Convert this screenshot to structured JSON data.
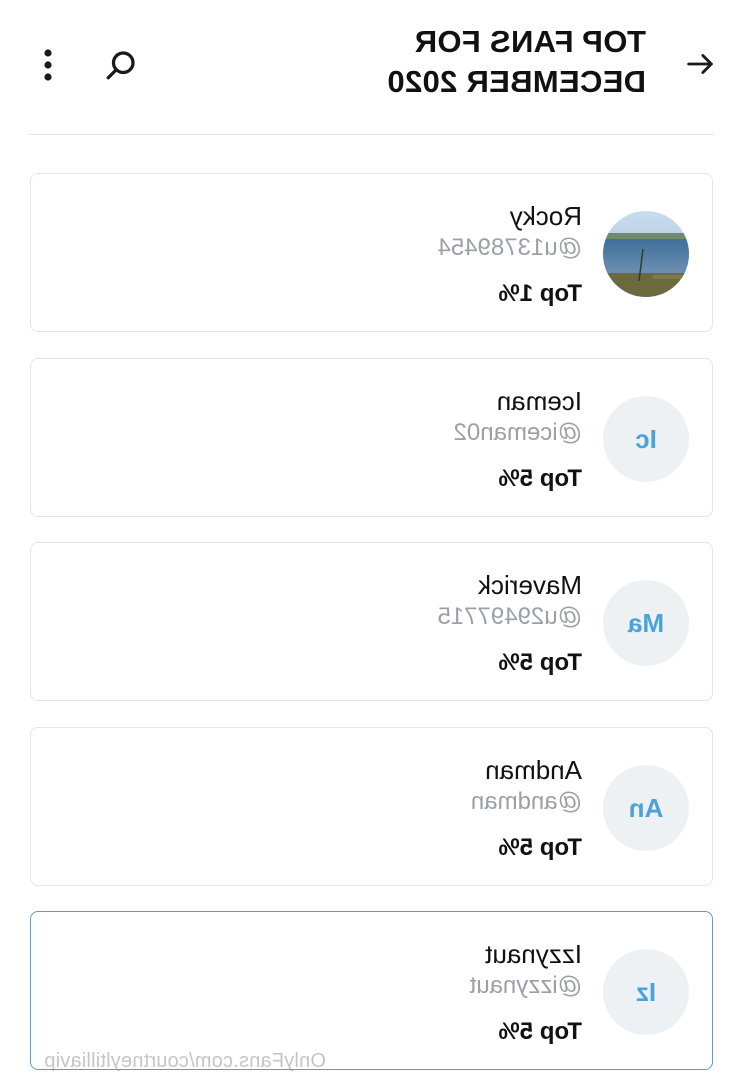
{
  "header": {
    "title": "TOP FANS FOR DECEMBER 2020",
    "back_icon": "arrow-left-icon",
    "search_icon": "search-icon",
    "more_icon": "more-vertical-icon"
  },
  "fans": [
    {
      "initials": "",
      "avatar": "photo",
      "name": "Rocky",
      "handle": "@u13789454",
      "rank": "Top 1%"
    },
    {
      "initials": "Ic",
      "avatar": "initials",
      "name": "Iceman",
      "handle": "@iceman02",
      "rank": "Top 5%"
    },
    {
      "initials": "Ma",
      "avatar": "initials",
      "name": "Maverick",
      "handle": "@u29497715",
      "rank": "Top 5%"
    },
    {
      "initials": "An",
      "avatar": "initials",
      "name": "Andman",
      "handle": "@andman",
      "rank": "Top 5%"
    },
    {
      "initials": "Iz",
      "avatar": "initials",
      "name": "Izzynaut",
      "handle": "@izzynaut",
      "rank": "Top 5%"
    }
  ],
  "watermark": "OnlyFans.com/courtneyltilliavip",
  "colors": {
    "accent": "#4ba3d7",
    "active_border": "#5d9cc4",
    "muted_text": "#9aa0a6",
    "border": "#e3e5e8"
  }
}
